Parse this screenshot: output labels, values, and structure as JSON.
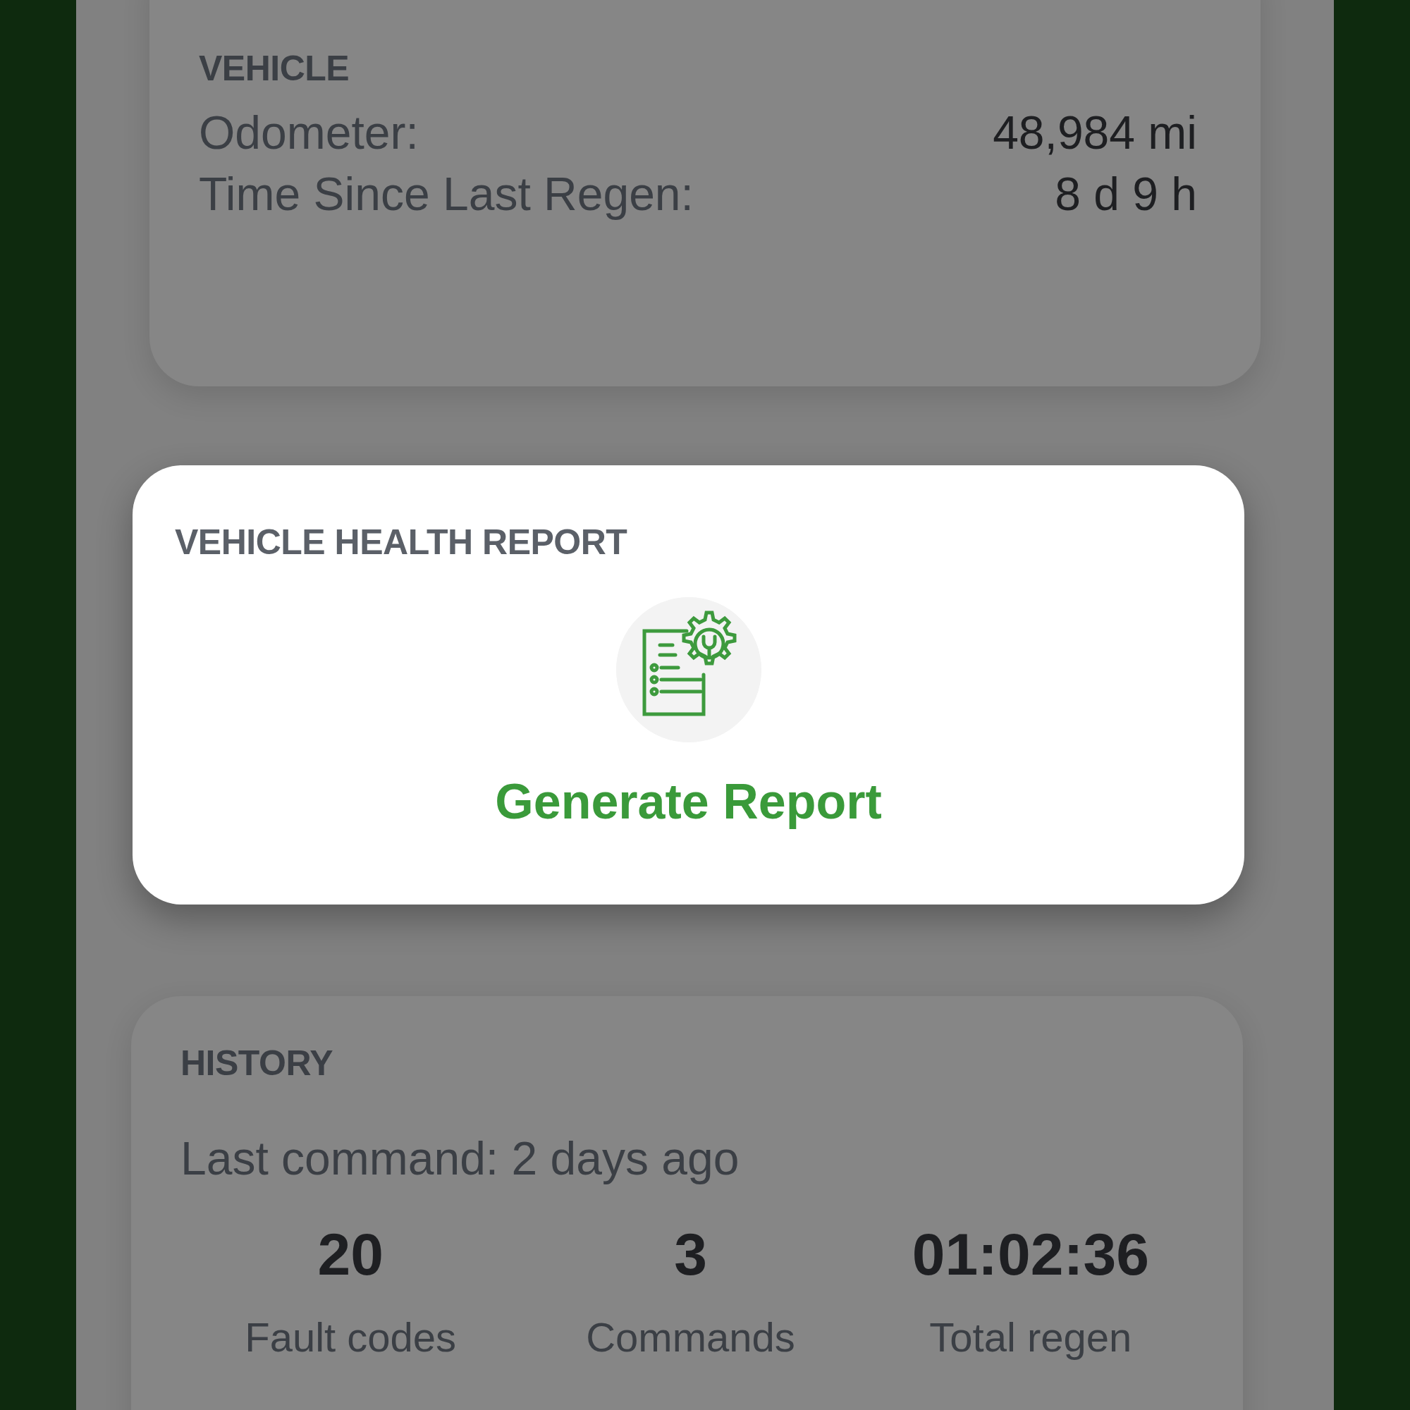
{
  "vehicle": {
    "title": "VEHICLE",
    "rows": [
      {
        "label": "Odometer:",
        "value": "48,984 mi"
      },
      {
        "label": "Time Since Last Regen:",
        "value": "8 d 9 h"
      }
    ]
  },
  "health_report": {
    "title": "VEHICLE HEALTH REPORT",
    "button": "Generate Report"
  },
  "history": {
    "title": "HISTORY",
    "last_command": "Last command: 2 days ago",
    "stats": [
      {
        "value": "20",
        "label": "Fault codes"
      },
      {
        "value": "3",
        "label": "Commands"
      },
      {
        "value": "01:02:36",
        "label": "Total regen"
      }
    ]
  }
}
